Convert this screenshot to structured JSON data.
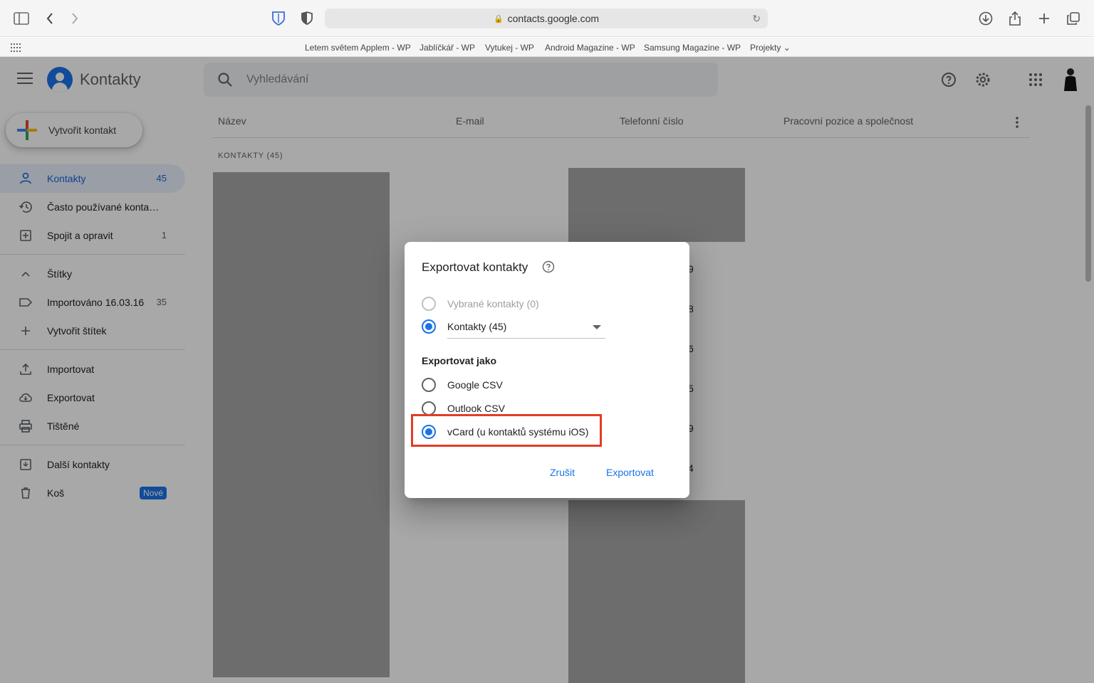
{
  "browser": {
    "url": "contacts.google.com",
    "bookmarks": [
      "Letem světem Applem - WP",
      "Jablíčkář - WP",
      "Vytukej - WP",
      "Android Magazine - WP",
      "Samsung Magazine - WP",
      "Projekty"
    ]
  },
  "header": {
    "app_title": "Kontakty",
    "search_placeholder": "Vyhledávání"
  },
  "sidebar": {
    "create_label": "Vytvořit kontakt",
    "items": [
      {
        "label": "Kontakty",
        "count": "45",
        "icon": "person-icon",
        "active": true
      },
      {
        "label": "Často používané konta…",
        "count": "",
        "icon": "history-icon"
      },
      {
        "label": "Spojit a opravit",
        "count": "1",
        "icon": "merge-icon"
      }
    ],
    "labels_heading": "Štítky",
    "label_items": [
      {
        "label": "Importováno 16.03.16",
        "count": "35",
        "icon": "label-icon"
      },
      {
        "label": "Vytvořit štítek",
        "icon": "plus-icon"
      }
    ],
    "actions": [
      {
        "label": "Importovat",
        "icon": "upload-icon"
      },
      {
        "label": "Exportovat",
        "icon": "cloud-download-icon"
      },
      {
        "label": "Tištěné",
        "icon": "print-icon"
      }
    ],
    "other": [
      {
        "label": "Další kontakty",
        "icon": "archive-icon"
      },
      {
        "label": "Koš",
        "icon": "trash-icon",
        "badge": "Nové"
      }
    ]
  },
  "table": {
    "columns": [
      "Název",
      "E-mail",
      "Telefonní číslo",
      "Pracovní pozice a společnost"
    ],
    "section_label": "KONTAKTY (45)",
    "phone_tail_digits": [
      "9",
      "8",
      "6",
      "5",
      "9",
      "4"
    ]
  },
  "dialog": {
    "title": "Exportovat kontakty",
    "options": {
      "selected_contacts": "Vybrané kontakty (0)",
      "contacts_group": "Kontakty (45)"
    },
    "export_as_label": "Exportovat jako",
    "formats": [
      "Google CSV",
      "Outlook CSV",
      "vCard (u kontaktů systému iOS)"
    ],
    "selected_format": "vCard (u kontaktů systému iOS)",
    "cancel_label": "Zrušit",
    "export_label": "Exportovat"
  },
  "colors": {
    "accent": "#1a73e8",
    "highlight_box": "#e33c27"
  }
}
